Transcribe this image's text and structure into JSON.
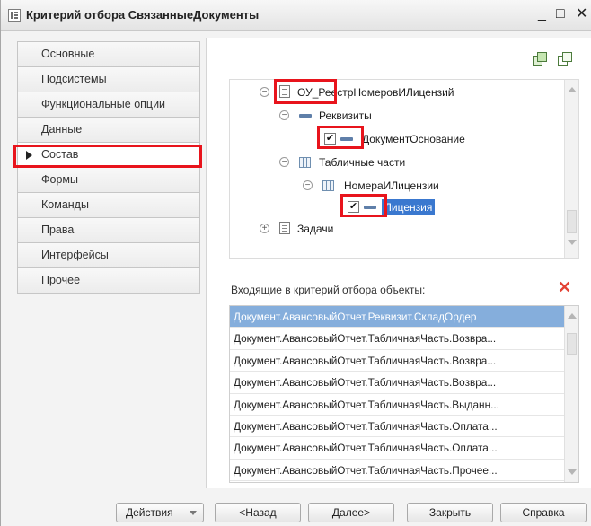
{
  "window": {
    "title": "Критерий отбора СвязанныеДокументы",
    "minimize": "_",
    "maximize": "□",
    "close": "✕"
  },
  "nav": {
    "items": [
      {
        "label": "Основные"
      },
      {
        "label": "Подсистемы"
      },
      {
        "label": "Функциональные опции"
      },
      {
        "label": "Данные"
      },
      {
        "label": "Состав",
        "active": true
      },
      {
        "label": "Формы"
      },
      {
        "label": "Команды"
      },
      {
        "label": "Права"
      },
      {
        "label": "Интерфейсы"
      },
      {
        "label": "Прочее"
      }
    ]
  },
  "toolbar": {
    "icons": [
      "check-all-icon",
      "uncheck-all-icon"
    ]
  },
  "tree": {
    "nodes": [
      {
        "label": "ОУ_РеестрНомеровИЛицензий",
        "icon": "document-icon",
        "expander": "⊖"
      },
      {
        "label": "Реквизиты",
        "icon": "attributes-icon",
        "expander": "⊖"
      },
      {
        "label": "ДокументОснование",
        "icon": "attribute-icon",
        "checked": true
      },
      {
        "label": "Табличные части",
        "icon": "table-icon",
        "expander": "⊖"
      },
      {
        "label": "НомераИЛицензии",
        "icon": "table-icon",
        "expander": "⊖"
      },
      {
        "label": "Лицензия",
        "icon": "attribute-icon",
        "checked": true,
        "selected": true
      },
      {
        "label": "Задачи",
        "icon": "document-icon",
        "expander": "⊕"
      }
    ]
  },
  "incoming": {
    "label": "Входящие в критерий отбора объекты:",
    "items": [
      "Документ.АвансовыйОтчет.Реквизит.СкладОрдер",
      "Документ.АвансовыйОтчет.ТабличнаяЧасть.Возвра...",
      "Документ.АвансовыйОтчет.ТабличнаяЧасть.Возвра...",
      "Документ.АвансовыйОтчет.ТабличнаяЧасть.Возвра...",
      "Документ.АвансовыйОтчет.ТабличнаяЧасть.Выданн...",
      "Документ.АвансовыйОтчет.ТабличнаяЧасть.Оплата...",
      "Документ.АвансовыйОтчет.ТабличнаяЧасть.Оплата...",
      "Документ.АвансовыйОтчет.ТабличнаяЧасть.Прочее..."
    ]
  },
  "footer": {
    "actions": "Действия",
    "back": "<Назад",
    "next": "Далее>",
    "close": "Закрыть",
    "help": "Справка"
  },
  "colors": {
    "highlight": "#e8141c",
    "selection": "#3a78cf",
    "list_selection": "#85aedc"
  }
}
